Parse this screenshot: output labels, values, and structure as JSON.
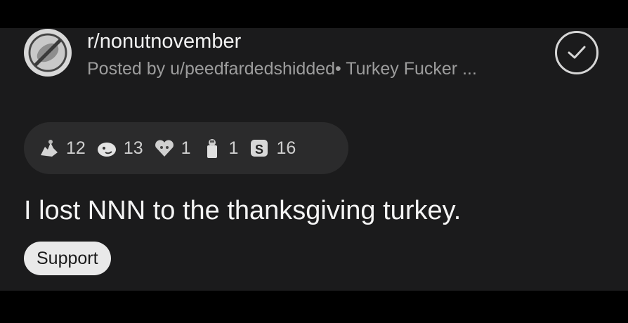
{
  "post": {
    "subreddit": "r/nonutnovember",
    "meta": "Posted by u/peedfardedshidded• Turkey Fucker ...",
    "title": "I lost NNN to the thanksgiving turkey.",
    "flair": "Support"
  },
  "awards": [
    {
      "icon": "hands-award-icon",
      "count": "12"
    },
    {
      "icon": "face-award-icon",
      "count": "13"
    },
    {
      "icon": "heart-award-icon",
      "count": "1"
    },
    {
      "icon": "figure-award-icon",
      "count": "1"
    },
    {
      "icon": "coin-award-icon",
      "count": "16"
    }
  ]
}
